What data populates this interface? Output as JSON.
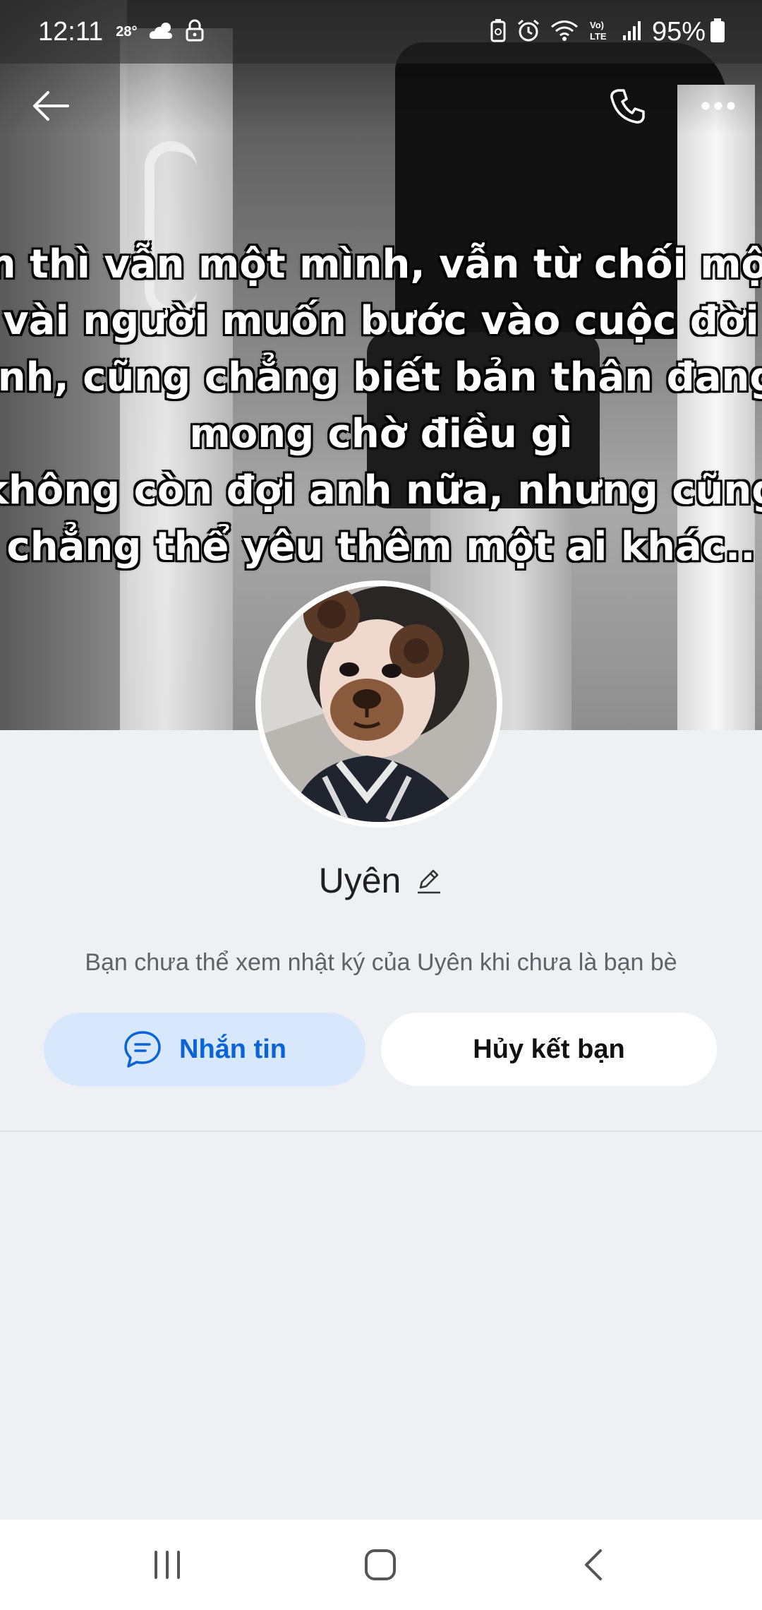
{
  "status_bar": {
    "time": "12:11",
    "temperature": "28°",
    "battery_percent": "95%",
    "icons": [
      "cloud-sun-icon",
      "lock-icon",
      "battery-saver-icon",
      "alarm-icon",
      "wifi-icon",
      "volte-icon",
      "signal-icon",
      "battery-icon"
    ]
  },
  "cover": {
    "caption_lines": [
      "m thì vẫn một mình, vẫn từ chối một",
      "vài người muốn bước vào cuộc đời",
      "ình, cũng chẳng biết bản thân đang",
      "mong chờ điều gì",
      "không còn đợi anh nữa, nhưng cũng",
      "chẳng thể yêu thêm một ai khác.."
    ]
  },
  "top_nav": {
    "icons": [
      "arrow-left-icon",
      "phone-icon",
      "more-horizontal-icon"
    ]
  },
  "profile": {
    "name": "Uyên",
    "diary_note": "Bạn chưa thể xem nhật ký của Uyên khi chưa là bạn bè"
  },
  "actions": {
    "message_label": "Nhắn tin",
    "unfriend_label": "Hủy kết bạn"
  },
  "colors": {
    "accent_blue": "#0b63d8",
    "message_button_bg": "#d8e8fc",
    "page_bg": "#eef0f4"
  },
  "system_nav": {
    "icons": [
      "recent-apps-icon",
      "home-icon",
      "back-icon"
    ]
  }
}
